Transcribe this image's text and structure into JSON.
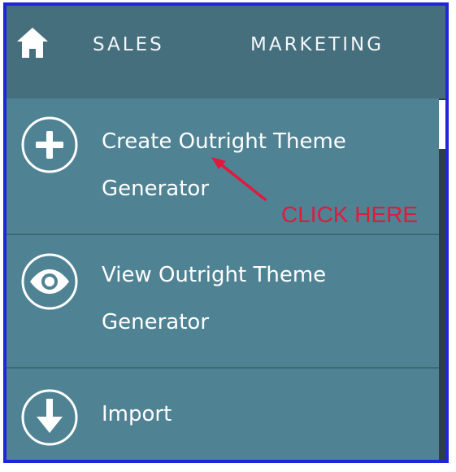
{
  "topbar": {
    "home_icon": "home-icon",
    "nav": [
      {
        "label": "SALES"
      },
      {
        "label": "MARKETING"
      }
    ]
  },
  "menu": {
    "items": [
      {
        "label": "Create Outright Theme Generator",
        "icon": "plus-circle-icon"
      },
      {
        "label": "View Outright Theme Generator",
        "icon": "eye-circle-icon"
      },
      {
        "label": "Import",
        "icon": "download-circle-icon"
      }
    ]
  },
  "annotation": {
    "text": "CLICK HERE",
    "color": "#e3193b"
  },
  "colors": {
    "frame_border": "#1e27d8",
    "topbar_bg": "#466f7e",
    "menu_bg": "#4f8394",
    "divider": "#3f6876",
    "text": "#ffffff"
  }
}
